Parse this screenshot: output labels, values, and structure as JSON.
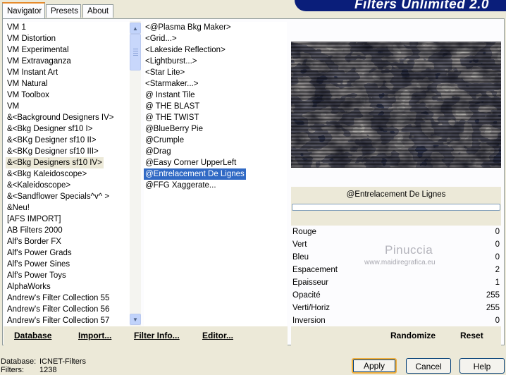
{
  "tabs": [
    "Navigator",
    "Presets",
    "About"
  ],
  "banner_title": "Filters Unlimited 2.0",
  "category_list": [
    "VM 1",
    "VM Distortion",
    "VM Experimental",
    "VM Extravaganza",
    "VM Instant Art",
    "VM Natural",
    "VM Toolbox",
    "VM",
    "&<Background Designers IV>",
    "&<Bkg Designer sf10 I>",
    "&<BKg Designer sf10 II>",
    "&<BKg Designer sf10 III>",
    "&<Bkg Designers sf10 IV>",
    "&<Bkg Kaleidoscope>",
    "&<Kaleidoscope>",
    "&<Sandflower Specials^v^ >",
    "&Neu!",
    "[AFS IMPORT]",
    "AB Filters 2000",
    "Alf's Border FX",
    "Alf's Power Grads",
    "Alf's Power Sines",
    "Alf's Power Toys",
    "AlphaWorks",
    "Andrew's Filter Collection 55",
    "Andrew's Filter Collection 56",
    "Andrew's Filter Collection 57"
  ],
  "category_selected_index": 12,
  "filter_list": [
    "<@Plasma Bkg Maker>",
    "<Grid...>",
    "<Lakeside Reflection>",
    "<Lightburst...>",
    "<Star Lite>",
    "<Starmaker...>",
    "@ Instant Tile",
    "@ THE BLAST",
    "@ THE TWIST",
    "@BlueBerry Pie",
    "@Crumple",
    "@Drag",
    "@Easy Corner UpperLeft",
    "@Entrelacement De Lignes",
    "@FFG Xaggerate..."
  ],
  "filter_selected_index": 13,
  "toolbar": {
    "database": "Database",
    "import": "Import...",
    "filter_info": "Filter Info...",
    "editor": "Editor..."
  },
  "preview": {
    "caption": "@Entrelacement De Lignes",
    "progress": 0
  },
  "params": [
    {
      "label": "Rouge",
      "value": "0"
    },
    {
      "label": "Vert",
      "value": "0"
    },
    {
      "label": "Bleu",
      "value": "0"
    },
    {
      "label": "Espacement",
      "value": "2"
    },
    {
      "label": "Epaisseur",
      "value": "1"
    },
    {
      "label": "Opacité",
      "value": "255"
    },
    {
      "label": "Verti/Horiz",
      "value": "255"
    },
    {
      "label": "Inversion",
      "value": "0"
    }
  ],
  "randomize_label": "Randomize",
  "reset_label": "Reset",
  "watermark": {
    "name": "Pinuccia",
    "url": "www.maidiregrafica.eu"
  },
  "status": {
    "database_label": "Database:",
    "database_value": "ICNET-Filters",
    "filters_label": "Filters:",
    "filters_value": "1238"
  },
  "buttons": {
    "apply": "Apply",
    "cancel": "Cancel",
    "help": "Help"
  },
  "colors": {
    "banner": "#0a1e7a",
    "selection": "#316ac5",
    "accent_tab": "#e68b2c"
  }
}
